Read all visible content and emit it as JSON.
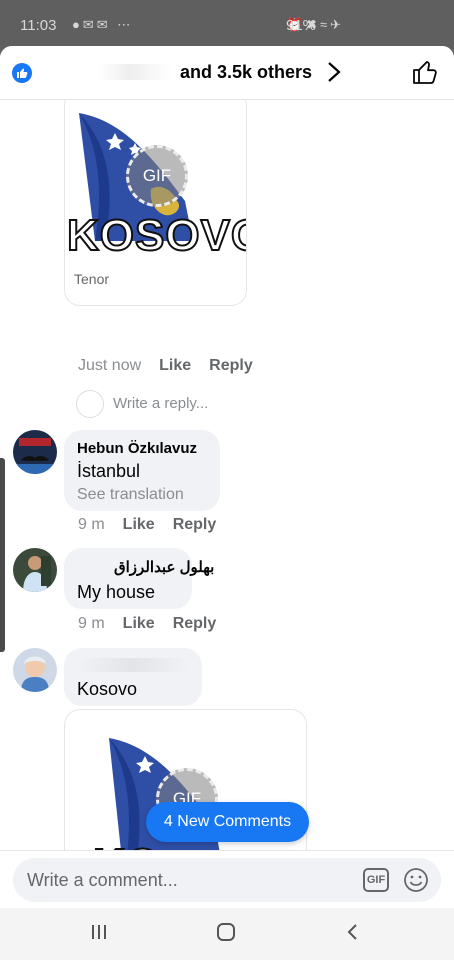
{
  "status_bar": {
    "time": "11:03",
    "battery": "91%"
  },
  "header": {
    "reactions_text": "and 3.5k others"
  },
  "gif_card_1": {
    "gif_label": "GIF",
    "overlay_text": "KOSOVO",
    "source": "Tenor"
  },
  "gif_card_1_meta": {
    "time": "Just now",
    "like": "Like",
    "reply": "Reply"
  },
  "reply_box": {
    "placeholder": "Write a reply..."
  },
  "comments": [
    {
      "name": "Hebun Özkılavuz",
      "text": "İstanbul",
      "translation": "See translation",
      "time": "9 m",
      "like": "Like",
      "reply": "Reply"
    },
    {
      "name": "بهلول عبدالرزاق",
      "text": "My house",
      "time": "9 m",
      "like": "Like",
      "reply": "Reply"
    },
    {
      "text": "Kosovo"
    }
  ],
  "gif_card_2": {
    "gif_label": "GIF",
    "overlay_text": "KO"
  },
  "new_comments_pill": "4 New Comments",
  "composer": {
    "placeholder": "Write a comment...",
    "gif_label": "GIF"
  },
  "colors": {
    "brand_blue": "#1877f2",
    "bubble_grey": "#f0f2f5",
    "flag_blue": "#2f4fa7",
    "flag_gold": "#d8b43c"
  }
}
